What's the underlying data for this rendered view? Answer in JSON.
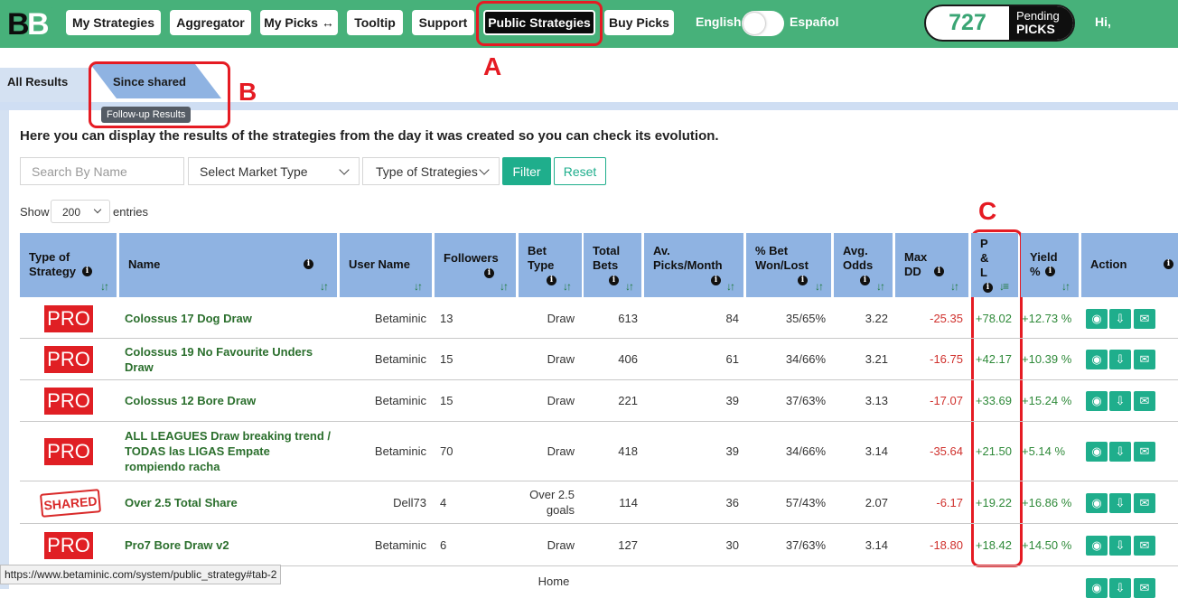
{
  "header": {
    "nav": [
      {
        "label": "My Strategies"
      },
      {
        "label": "Aggregator"
      },
      {
        "label": "My Picks ↔"
      },
      {
        "label": "Tooltip"
      },
      {
        "label": "Support"
      },
      {
        "label": "Public Strategies"
      },
      {
        "label": "Buy Picks"
      }
    ],
    "lang_en": "English",
    "lang_es": "Español",
    "pending_count": "727",
    "pending_label_1": "Pending",
    "pending_label_2": "PICKS",
    "greeting": "Hi,"
  },
  "tabs": {
    "all": "All Results",
    "since": "Since shared",
    "tooltip": "Follow-up Results"
  },
  "annotations": {
    "a": "A",
    "b": "B",
    "c": "C",
    "color": "#e51b23"
  },
  "intro": "Here you can display the results of the strategies from the day it was created so you can check its evolution.",
  "filters": {
    "search_placeholder": "Search By Name",
    "market": "Select Market Type",
    "strategy_type": "Type of Strategies",
    "filter_btn": "Filter",
    "reset_btn": "Reset"
  },
  "entries": {
    "show": "Show",
    "value": "200",
    "label": "entries"
  },
  "columns": {
    "type": "Type of Strategy",
    "name": "Name",
    "user": "User Name",
    "followers": "Followers",
    "bet_type": "Bet Type",
    "total_bets": "Total Bets",
    "av_picks": "Av. Picks/Month",
    "pct": "% Bet Won/Lost",
    "odds": "Avg. Odds",
    "maxdd": "Max DD",
    "pl": "P & L",
    "yield": "Yield %",
    "action": "Action"
  },
  "rows": [
    {
      "type": "PRO",
      "name": "Colossus 17 Dog Draw",
      "user": "Betaminic",
      "followers": "13",
      "bet": "Draw",
      "bets": "613",
      "picks": "84",
      "pct": "35/65%",
      "odds": "3.22",
      "dd": "-25.35",
      "pl": "+78.02",
      "yield": "+12.73 %"
    },
    {
      "type": "PRO",
      "name": "Colossus 19 No Favourite Unders Draw",
      "user": "Betaminic",
      "followers": "15",
      "bet": "Draw",
      "bets": "406",
      "picks": "61",
      "pct": "34/66%",
      "odds": "3.21",
      "dd": "-16.75",
      "pl": "+42.17",
      "yield": "+10.39 %"
    },
    {
      "type": "PRO",
      "name": "Colossus 12 Bore Draw",
      "user": "Betaminic",
      "followers": "15",
      "bet": "Draw",
      "bets": "221",
      "picks": "39",
      "pct": "37/63%",
      "odds": "3.13",
      "dd": "-17.07",
      "pl": "+33.69",
      "yield": "+15.24 %"
    },
    {
      "type": "PRO",
      "name": "ALL LEAGUES Draw breaking trend / TODAS las LIGAS Empate rompiendo racha",
      "user": "Betaminic",
      "followers": "70",
      "bet": "Draw",
      "bets": "418",
      "picks": "39",
      "pct": "34/66%",
      "odds": "3.14",
      "dd": "-35.64",
      "pl": "+21.50",
      "yield": "+5.14 %"
    },
    {
      "type": "SHARED",
      "name": "Over 2.5 Total Share",
      "user": "Dell73",
      "followers": "4",
      "bet": "Over 2.5 goals",
      "bets": "114",
      "picks": "36",
      "pct": "57/43%",
      "odds": "2.07",
      "dd": "-6.17",
      "pl": "+19.22",
      "yield": "+16.86 %"
    },
    {
      "type": "PRO",
      "name": "Pro7 Bore Draw v2",
      "user": "Betaminic",
      "followers": "6",
      "bet": "Draw",
      "bets": "127",
      "picks": "30",
      "pct": "37/63%",
      "odds": "3.14",
      "dd": "-18.80",
      "pl": "+18.42",
      "yield": "+14.50 %"
    }
  ],
  "partial_row_bet": "Home",
  "status_url": "https://www.betaminic.com/system/public_strategy#tab-2",
  "colors": {
    "topbar": "#47b17a",
    "header_cells": "#8fb3e2",
    "action_buttons": "#1fae8c",
    "negative": "#d0312d",
    "positive": "#2f8a3a"
  }
}
